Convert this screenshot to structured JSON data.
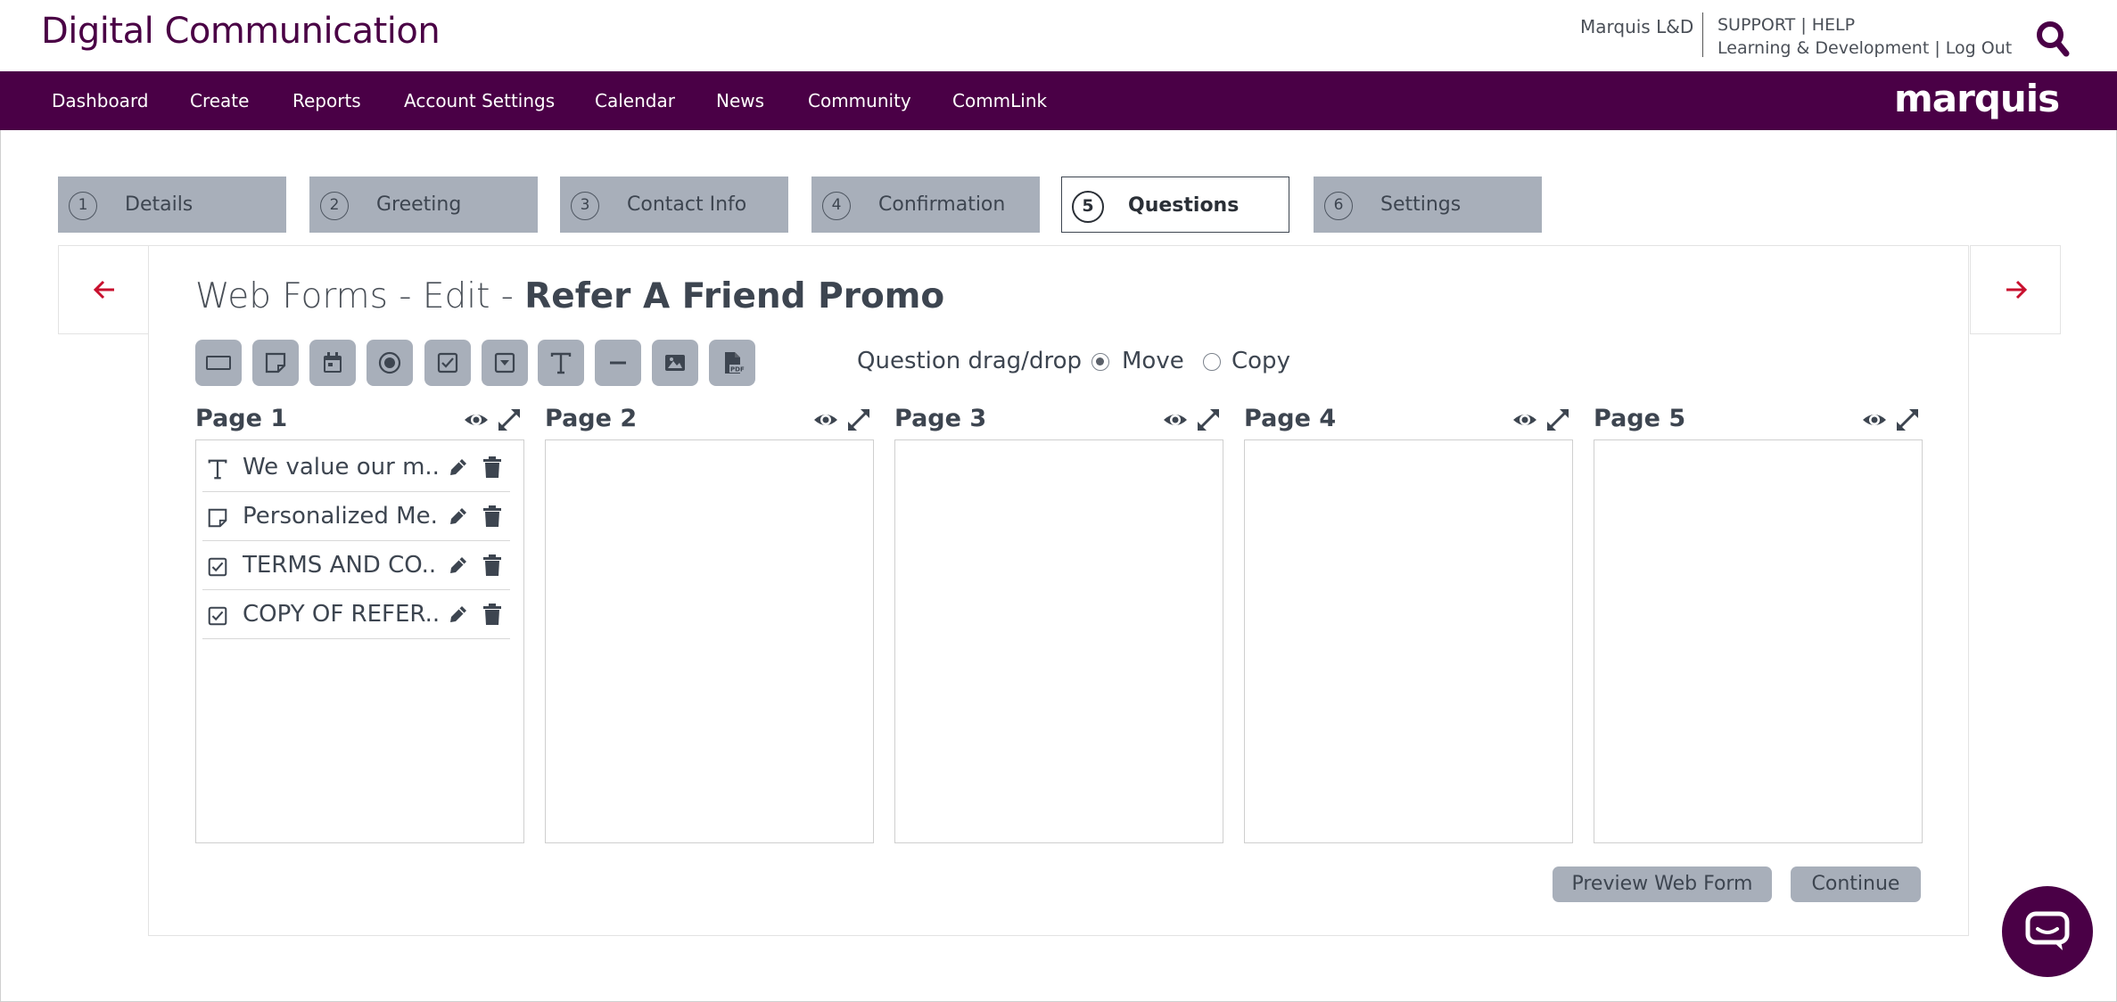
{
  "header": {
    "brand": "Digital Communication",
    "account": "Marquis L&D",
    "support_label": "SUPPORT",
    "help_label": "HELP",
    "org_label": "Learning & Development",
    "logout_label": "Log Out",
    "separator": "|"
  },
  "nav": {
    "items": [
      "Dashboard",
      "Create",
      "Reports",
      "Account Settings",
      "Calendar",
      "News",
      "Community",
      "CommLink"
    ],
    "logo": "marquis"
  },
  "steps": [
    {
      "num": "1",
      "label": "Details"
    },
    {
      "num": "2",
      "label": "Greeting"
    },
    {
      "num": "3",
      "label": "Contact Info"
    },
    {
      "num": "4",
      "label": "Confirmation"
    },
    {
      "num": "5",
      "label": "Questions",
      "active": true
    },
    {
      "num": "6",
      "label": "Settings"
    }
  ],
  "title": {
    "prefix": "Web Forms - Edit - ",
    "name": "Refer A Friend Promo"
  },
  "toolbar": {
    "icons": [
      "text-box-icon",
      "note-icon",
      "calendar-icon",
      "radio-icon",
      "checkbox-icon",
      "dropdown-icon",
      "text-icon",
      "divider-icon",
      "image-icon",
      "pdf-icon"
    ]
  },
  "dragdrop": {
    "label": "Question drag/drop",
    "options": [
      {
        "label": "Move",
        "selected": true
      },
      {
        "label": "Copy",
        "selected": false
      }
    ]
  },
  "pages": [
    {
      "title": "Page 1"
    },
    {
      "title": "Page 2"
    },
    {
      "title": "Page 3"
    },
    {
      "title": "Page 4"
    },
    {
      "title": "Page 5"
    }
  ],
  "questions": [
    {
      "icon": "text-icon",
      "label": "We value our m..."
    },
    {
      "icon": "note-icon",
      "label": "Personalized Me..."
    },
    {
      "icon": "checkbox-icon",
      "label": "TERMS AND CO..."
    },
    {
      "icon": "checkbox-icon",
      "label": "COPY OF REFER..."
    }
  ],
  "actions": {
    "preview": "Preview Web Form",
    "continue": "Continue"
  },
  "colors": {
    "brand": "#4a0046",
    "tab_bg": "#a8afba",
    "arrow": "#c8102e",
    "text": "#3d4550"
  }
}
